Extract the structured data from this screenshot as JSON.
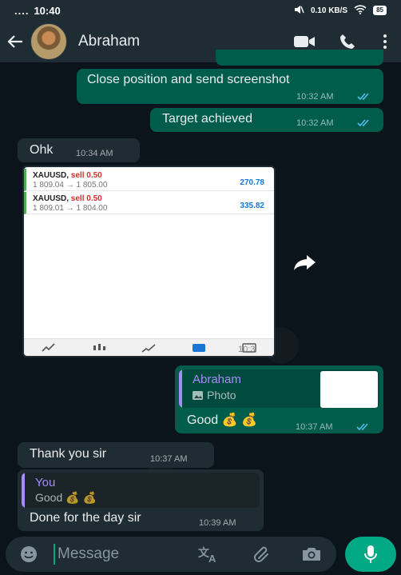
{
  "status_bar": {
    "time": "10:40",
    "data_rate": "0.10 KB/S",
    "battery": "85"
  },
  "header": {
    "contact_name": "Abraham",
    "icons": [
      "back-arrow-icon",
      "video-call-icon",
      "voice-call-icon",
      "more-options-icon"
    ]
  },
  "messages": [
    {
      "direction": "out",
      "text": "Close position and send screenshot",
      "time": "10:32 AM",
      "read": true
    },
    {
      "direction": "out",
      "text": "Target achieved",
      "time": "10:32 AM",
      "read": true
    },
    {
      "direction": "in",
      "text": "Ohk",
      "time": "10:34 AM"
    },
    {
      "direction": "in",
      "type": "image",
      "trades": [
        {
          "symbol": "XAUUSD,",
          "side": "sell 0.50",
          "prices": "1 809.04 → 1 805.00",
          "profit": "270.78"
        },
        {
          "symbol": "XAUUSD,",
          "side": "sell 0.50",
          "prices": "1 809.01 → 1 804.00",
          "profit": "335.82"
        }
      ],
      "time": "10:3"
    },
    {
      "direction": "out",
      "reply_to": {
        "name": "Abraham",
        "label": "Photo"
      },
      "text": "Good 💰 💰",
      "time": "10:37 AM",
      "read": true
    },
    {
      "direction": "in",
      "text": "Thank you sir",
      "time": "10:37 AM"
    },
    {
      "direction": "in",
      "reply_to": {
        "name": "You",
        "label": "Good 💰 💰"
      },
      "text": "Done for the day sir",
      "time": "10:39 AM"
    }
  ],
  "composer": {
    "placeholder": "Message"
  },
  "colors": {
    "header_bg": "#1f2c34",
    "chat_bg": "#0b141a",
    "outgoing_bubble": "#005c4b",
    "incoming_bubble": "#202c33",
    "accent": "#00a884",
    "read_ticks": "#53bdeb",
    "quote_abraham": "#a78bfa",
    "quote_you": "#a78bfa"
  }
}
